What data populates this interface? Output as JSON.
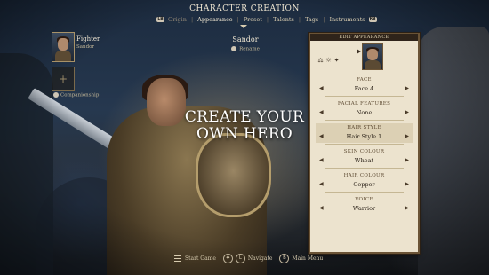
{
  "header": {
    "title": "CHARACTER CREATION",
    "tabs": [
      {
        "label": "Origin",
        "state": "dim"
      },
      {
        "label": "Appearance",
        "state": "active"
      },
      {
        "label": "Preset",
        "state": "normal"
      },
      {
        "label": "Talents",
        "state": "normal"
      },
      {
        "label": "Tags",
        "state": "normal"
      },
      {
        "label": "Instruments",
        "state": "normal"
      }
    ],
    "left_bumper": "LB",
    "right_bumper": "RB"
  },
  "character": {
    "name": "Sandor",
    "rename_label": "Rename"
  },
  "party": {
    "name": "Fighter",
    "class": "Sandor",
    "empty_slot": "+",
    "caption": "Companionship"
  },
  "headline": "CREATE YOUR OWN HERO",
  "panel": {
    "title": "EDIT APPEARANCE",
    "icons": [
      "⚖",
      "☼",
      "✦"
    ],
    "options": [
      {
        "label": "FACE",
        "value": "Face 4"
      },
      {
        "label": "FACIAL FEATURES",
        "value": "None"
      },
      {
        "label": "HAIR STYLE",
        "value": "Hair Style 1"
      },
      {
        "label": "SKIN COLOUR",
        "value": "Wheat"
      },
      {
        "label": "HAIR COLOUR",
        "value": "Copper"
      },
      {
        "label": "VOICE",
        "value": "Warrior"
      }
    ],
    "left_arrow": "◀",
    "right_arrow": "▶"
  },
  "footer": {
    "start_game": "Start Game",
    "navigate": "Navigate",
    "main_menu": "Main Menu"
  }
}
